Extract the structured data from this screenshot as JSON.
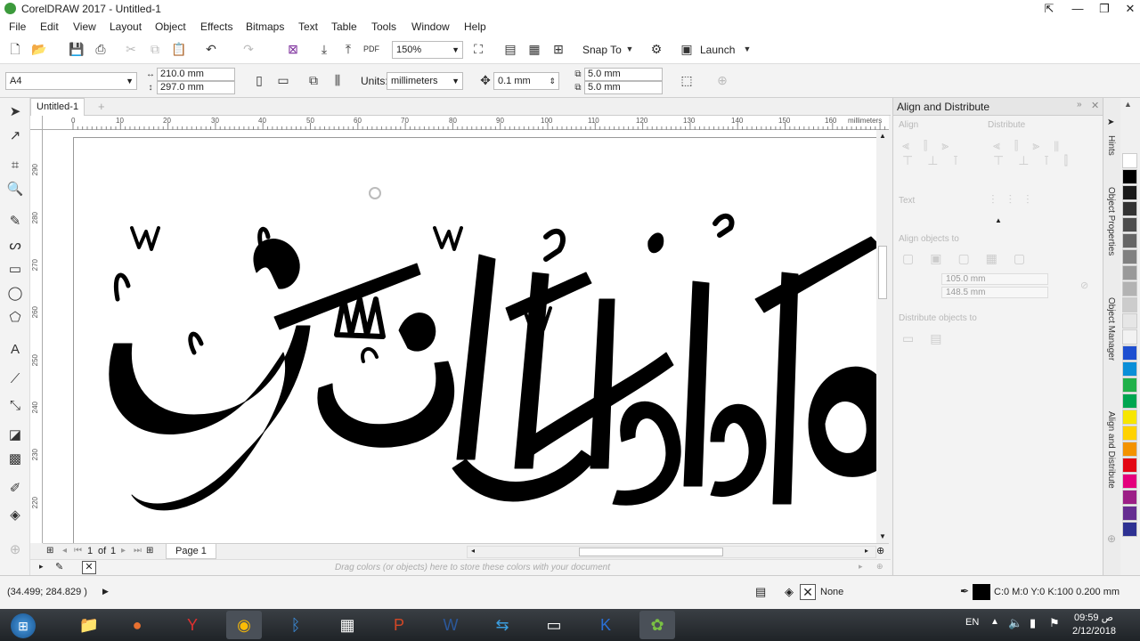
{
  "window": {
    "title": "CorelDRAW 2017 - Untitled-1"
  },
  "menu": [
    "File",
    "Edit",
    "View",
    "Layout",
    "Object",
    "Effects",
    "Bitmaps",
    "Text",
    "Table",
    "Tools",
    "Window",
    "Help"
  ],
  "std_toolbar": {
    "zoom": "150%",
    "snap_label": "Snap To",
    "launch_label": "Launch"
  },
  "prop_bar": {
    "page_size": "A4",
    "width": "210.0 mm",
    "height": "297.0 mm",
    "units_label": "Units:",
    "units_value": "millimeters",
    "nudge": "0.1 mm",
    "dup_x": "5.0 mm",
    "dup_y": "5.0 mm"
  },
  "doc_tab": "Untitled-1",
  "ruler": {
    "h_labels": [
      "0",
      "10",
      "20",
      "30",
      "40",
      "50",
      "60",
      "70",
      "80",
      "90",
      "100",
      "110",
      "120",
      "130",
      "140",
      "150",
      "160"
    ],
    "unit": "millimeters",
    "v_labels": [
      "290",
      "280",
      "270",
      "260",
      "250",
      "240",
      "230",
      "220"
    ]
  },
  "page_nav": {
    "current": "1",
    "of": "of",
    "total": "1",
    "page_tab": "Page 1"
  },
  "palette_hint": "Drag colors (or objects) here to store these colors with your document",
  "docker": {
    "title": "Align and Distribute",
    "align": "Align",
    "distribute": "Distribute",
    "text": "Text",
    "align_objects_to": "Align objects to",
    "x": "105.0 mm",
    "y": "148.5 mm",
    "distribute_objects_to": "Distribute objects to"
  },
  "side_tabs": [
    "Hints",
    "Object Properties",
    "Object Manager",
    "Align and Distribute"
  ],
  "palette_colors": [
    "#ffffff",
    "#000000",
    "#1a1a1a",
    "#333333",
    "#4d4d4d",
    "#666666",
    "#808080",
    "#999999",
    "#b3b3b3",
    "#cccccc",
    "#e6e6e6",
    "#f2f2f2",
    "#1e4fd1",
    "#0a8fd8",
    "#21b14a",
    "#00a651",
    "#f7e600",
    "#ffd200",
    "#f39200",
    "#e30613",
    "#e4007c",
    "#9c1f86",
    "#662d91",
    "#2e3192"
  ],
  "status": {
    "coords": "(34.499; 284.829 )",
    "fill": "None",
    "outline": "C:0 M:0 Y:0 K:100  0.200 mm"
  },
  "tray": {
    "lang": "EN",
    "time": "09:59 ص",
    "date": "2/12/2018"
  },
  "colors": {
    "accent": "#2b579a",
    "windows_taskbar": "#2a2e33"
  }
}
